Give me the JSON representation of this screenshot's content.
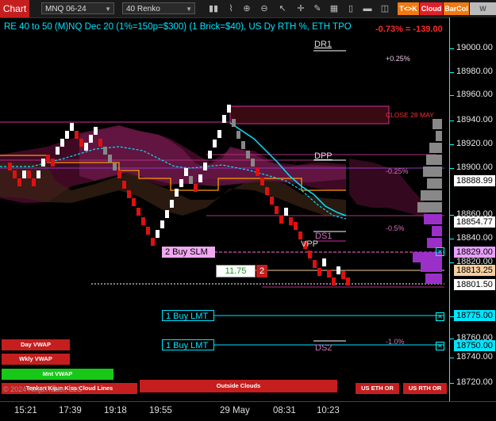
{
  "toolbar": {
    "chart_label": "Chart",
    "instrument": "MNQ 06-24",
    "bartype": "40 Renko",
    "btn_tk": "T<>K",
    "btn_cloud": "Cloud",
    "btn_barcol": "BarCol",
    "btn_vwap": "W VWAP"
  },
  "header": {
    "description": "RE 40 to 50 (M)NQ Dec 20 (1%=150p=$300) (1 Brick=$40), US Dy RTH %, ETH TPO",
    "change": "-0.73% = -139.00"
  },
  "y_axis": {
    "ticks": [
      "19000.00",
      "18980.00",
      "18960.00",
      "18940.00",
      "18920.00",
      "18900.00",
      "18860.00",
      "18840.00",
      "18820.00",
      "18780.00",
      "18760.00",
      "18740.00",
      "18720.00"
    ],
    "price_labels": [
      {
        "value": "18888.99",
        "color": "#ffffff"
      },
      {
        "value": "18854.77",
        "color": "#ffffff"
      },
      {
        "value": "18829.00",
        "color": "#e8a0ff"
      },
      {
        "value": "18813.25",
        "color": "#f5cfa0"
      },
      {
        "value": "18801.50",
        "color": "#ffffff"
      },
      {
        "value": "18775.00",
        "color": "#00e5ff"
      },
      {
        "value": "18750.00",
        "color": "#00e5ff"
      }
    ]
  },
  "x_axis": {
    "ticks": [
      "15:21",
      "17:39",
      "19:18",
      "19:55",
      "29 May",
      "08:31",
      "10:23"
    ]
  },
  "levels": {
    "dr1": "DR1",
    "dpp": "DPP",
    "ds1": "DS1",
    "vpp": "VPP",
    "ds2": "DS2",
    "close": "CLOSE 28 MAY",
    "pct_p025": "+0.25%",
    "pct_m025": "-0.25%",
    "pct_m05": "-0.5%",
    "pct_m1": "-1.0%"
  },
  "orders": {
    "buy_slm": "2 Buy SLM",
    "buy_lmt1": "1 Buy LMT",
    "buy_lmt2": "1 Buy LMT",
    "position_price": "11.75",
    "position_qty": "2"
  },
  "tags": {
    "day_vwap": "Day VWAP",
    "wkly_vwap": "Wkly VWAP",
    "mnt_vwap": "Mnt VWAP",
    "tenkan": "Tenkan Kijun Kiss Cloud Lines",
    "outside": "Outside Clouds",
    "us_eth": "US ETH OR",
    "us_rth": "US RTH OR",
    "copyright": "© 2024 NinjaTrader, LLC"
  }
}
